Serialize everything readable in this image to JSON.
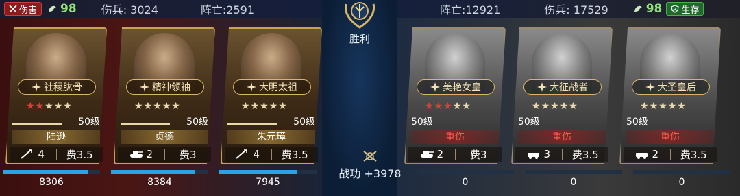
{
  "left": {
    "badge": "伤害",
    "morale": "98",
    "wounded": "伤兵: 3024",
    "dead": "阵亡:2591",
    "generals": [
      {
        "title": "社稷肱骨",
        "stars_red": 2,
        "stars_total": 5,
        "level": "50级",
        "name": "陆逊",
        "unit_count": "4",
        "cost": "费3.5",
        "hp": "8306",
        "hp_fraction": 0.88
      },
      {
        "title": "精神领袖",
        "stars_red": 0,
        "stars_total": 5,
        "level": "50级",
        "name": "贞德",
        "unit_count": "2",
        "cost": "费3",
        "hp": "8384",
        "hp_fraction": 0.86
      },
      {
        "title": "大明太祖",
        "stars_red": 0,
        "stars_total": 5,
        "level": "50级",
        "name": "朱元璋",
        "unit_count": "4",
        "cost": "费3.5",
        "hp": "7945",
        "hp_fraction": 0.8
      }
    ]
  },
  "right": {
    "dead": "阵亡:12921",
    "wounded": "伤兵: 17529",
    "morale": "98",
    "badge": "生存",
    "generals": [
      {
        "title": "美艳女皇",
        "stars_red": 3,
        "stars_total": 5,
        "level": "50级",
        "name": "重伤",
        "unit_count": "2",
        "cost": "费3",
        "hp": "0",
        "hp_fraction": 0.0
      },
      {
        "title": "大征战者",
        "stars_red": 0,
        "stars_total": 5,
        "level": "50级",
        "name": "重伤",
        "unit_count": "3",
        "cost": "费3.5",
        "hp": "0",
        "hp_fraction": 0.0
      },
      {
        "title": "大圣皇后",
        "stars_red": 0,
        "stars_total": 5,
        "level": "50级",
        "name": "重伤",
        "unit_count": "2",
        "cost": "费3.5",
        "hp": "0",
        "hp_fraction": 0.0
      }
    ]
  },
  "center": {
    "result": "胜利",
    "merit": "战功 +3978"
  },
  "icons": {
    "crest": "laurel-crest-icon",
    "damage": "crossed-swords-icon",
    "morale": "flexed-arm-icon",
    "survive": "shield-check-icon",
    "title": "compass-star-icon",
    "merit": "crossed-swords-merit-icon",
    "unit_left": [
      "spear-icon",
      "tank-icon",
      "spear-icon"
    ],
    "unit_right": [
      "tank-icon",
      "armored-car-icon",
      "armored-car-icon"
    ]
  },
  "colors": {
    "blue_hp": "#2aa3e6",
    "red_hp": "#c23a2a",
    "morale_green": "#8fe07b",
    "gold": "#c9a259"
  }
}
